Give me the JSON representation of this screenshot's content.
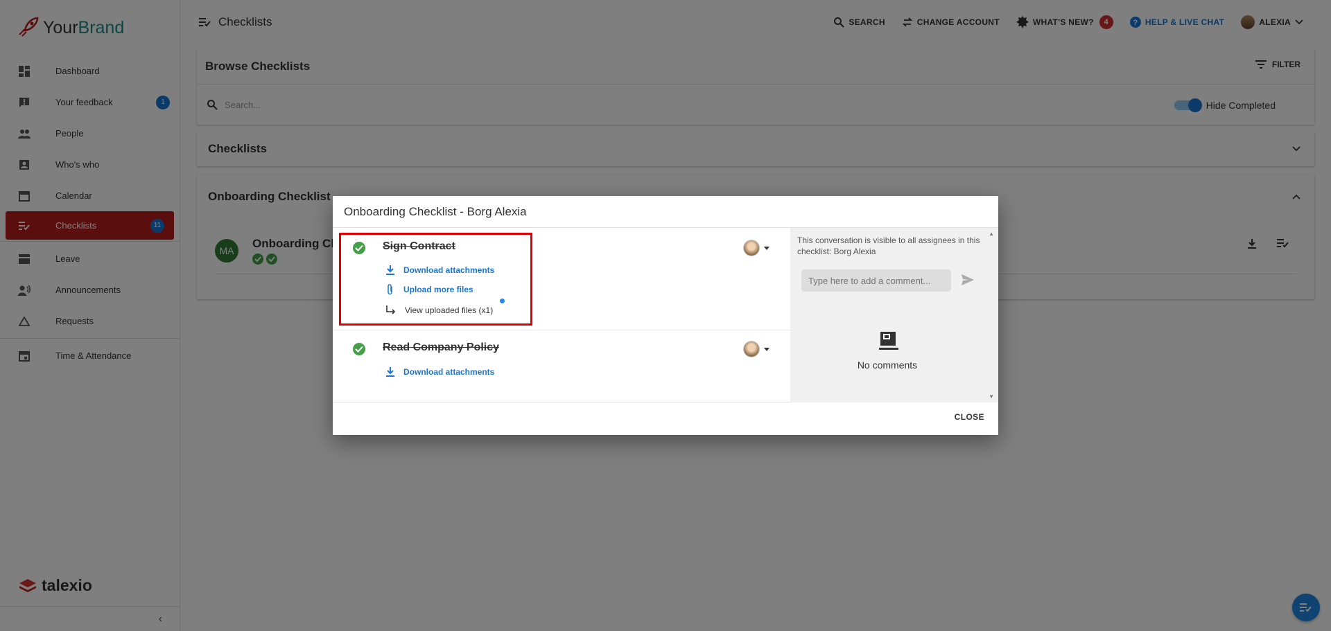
{
  "brand": {
    "part1": "Your",
    "part2": "Brand",
    "footer_logo": "talexio"
  },
  "sidebar": {
    "items": [
      {
        "label": "Dashboard",
        "icon": "dashboard-icon"
      },
      {
        "label": "Your feedback",
        "icon": "feedback-icon",
        "badge": "1"
      },
      {
        "label": "People",
        "icon": "people-icon"
      },
      {
        "label": "Who's who",
        "icon": "contact-icon"
      },
      {
        "label": "Calendar",
        "icon": "calendar-icon"
      },
      {
        "label": "Checklists",
        "icon": "checklist-icon",
        "badge": "11",
        "active": true
      },
      {
        "label": "Leave",
        "icon": "leave-icon"
      },
      {
        "label": "Announcements",
        "icon": "announcement-icon"
      },
      {
        "label": "Requests",
        "icon": "requests-icon"
      },
      {
        "label": "Time & Attendance",
        "icon": "time-icon"
      }
    ]
  },
  "header": {
    "title": "Checklists",
    "search": "SEARCH",
    "change_account": "CHANGE ACCOUNT",
    "whats_new": "WHAT'S NEW?",
    "whats_new_count": "4",
    "help": "HELP & LIVE CHAT",
    "user": "ALEXIA"
  },
  "browse": {
    "title": "Browse Checklists",
    "filter": "FILTER",
    "search_placeholder": "Search...",
    "hide_completed": "Hide Completed"
  },
  "checklists_section": {
    "title": "Checklists"
  },
  "onboarding_section": {
    "title": "Onboarding Checklist",
    "row_initials": "MA",
    "row_title": "Onboarding Ch"
  },
  "dialog": {
    "title": "Onboarding Checklist - Borg Alexia",
    "tasks": [
      {
        "name": "Sign Contract",
        "download": "Download attachments",
        "upload": "Upload more files",
        "view": "View uploaded files (x1)"
      },
      {
        "name": "Read Company Policy",
        "download": "Download attachments"
      }
    ],
    "comments": {
      "note": "This conversation is visible to all assignees in this checklist: Borg Alexia",
      "placeholder": "Type here to add a comment...",
      "empty": "No comments"
    },
    "close": "CLOSE"
  },
  "colors": {
    "accent": "#1976d2",
    "active_nav": "#b71c1c",
    "done": "#43a047",
    "highlight": "#e00000"
  }
}
